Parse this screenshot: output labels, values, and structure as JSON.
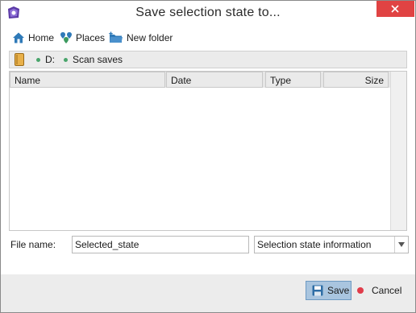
{
  "window": {
    "title": "Save selection state to..."
  },
  "toolbar": {
    "home_label": "Home",
    "places_label": "Places",
    "new_folder_label": "New folder"
  },
  "path": {
    "drive": "D:",
    "folder": "Scan saves"
  },
  "table": {
    "columns": [
      "Name",
      "Date",
      "Type",
      "Size"
    ],
    "rows": []
  },
  "filename": {
    "label": "File name:",
    "value": "Selected_state"
  },
  "filetype": {
    "selected": "Selection state information"
  },
  "buttons": {
    "save": "Save",
    "cancel": "Cancel"
  },
  "colors": {
    "accent": "#2f7ab8",
    "close": "#e04343",
    "cancel_dot": "#e03c4a",
    "path_dot": "#49a56b",
    "save_bg": "#a9c5df"
  }
}
